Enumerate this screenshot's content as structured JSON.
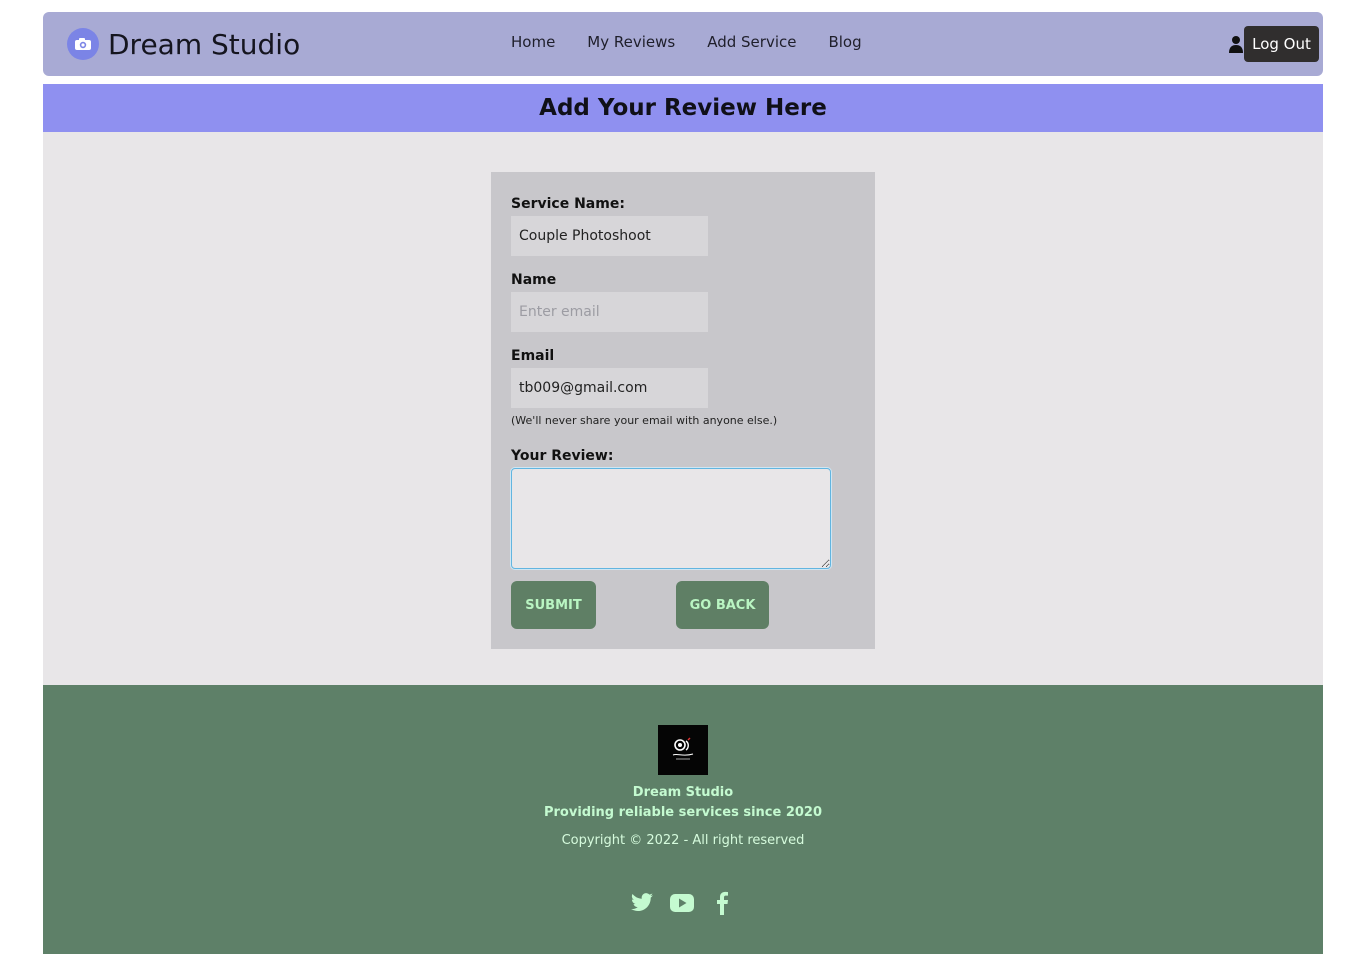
{
  "brand": {
    "name": "Dream Studio",
    "logo_icon": "camera-icon"
  },
  "nav": {
    "links": [
      "Home",
      "My Reviews",
      "Add Service",
      "Blog"
    ],
    "user_icon": "user-icon",
    "logout_label": "Log Out"
  },
  "banner": {
    "title": "Add Your Review Here"
  },
  "form": {
    "service_label": "Service Name:",
    "service_value": "Couple Photoshoot",
    "name_label": "Name",
    "name_placeholder": "Enter email",
    "email_label": "Email",
    "email_value": "tb009@gmail.com",
    "email_hint": "(We'll never share your email with anyone else.)",
    "review_label": "Your Review:",
    "review_value": "",
    "submit_label": "SUBMIT",
    "back_label": "GO BACK"
  },
  "footer": {
    "logo_icon": "photography-logo-icon",
    "name": "Dream Studio",
    "tagline": "Providing reliable services since 2020",
    "copyright": "Copyright © 2022 - All right reserved",
    "socials": [
      "twitter-icon",
      "youtube-icon",
      "facebook-icon"
    ]
  },
  "colors": {
    "navbar_bg": "#a8aad4",
    "banner_bg": "#8f90f0",
    "button_bg": "#5f7f65",
    "footer_bg": "#5e8068",
    "footer_text": "#c4fad0"
  }
}
